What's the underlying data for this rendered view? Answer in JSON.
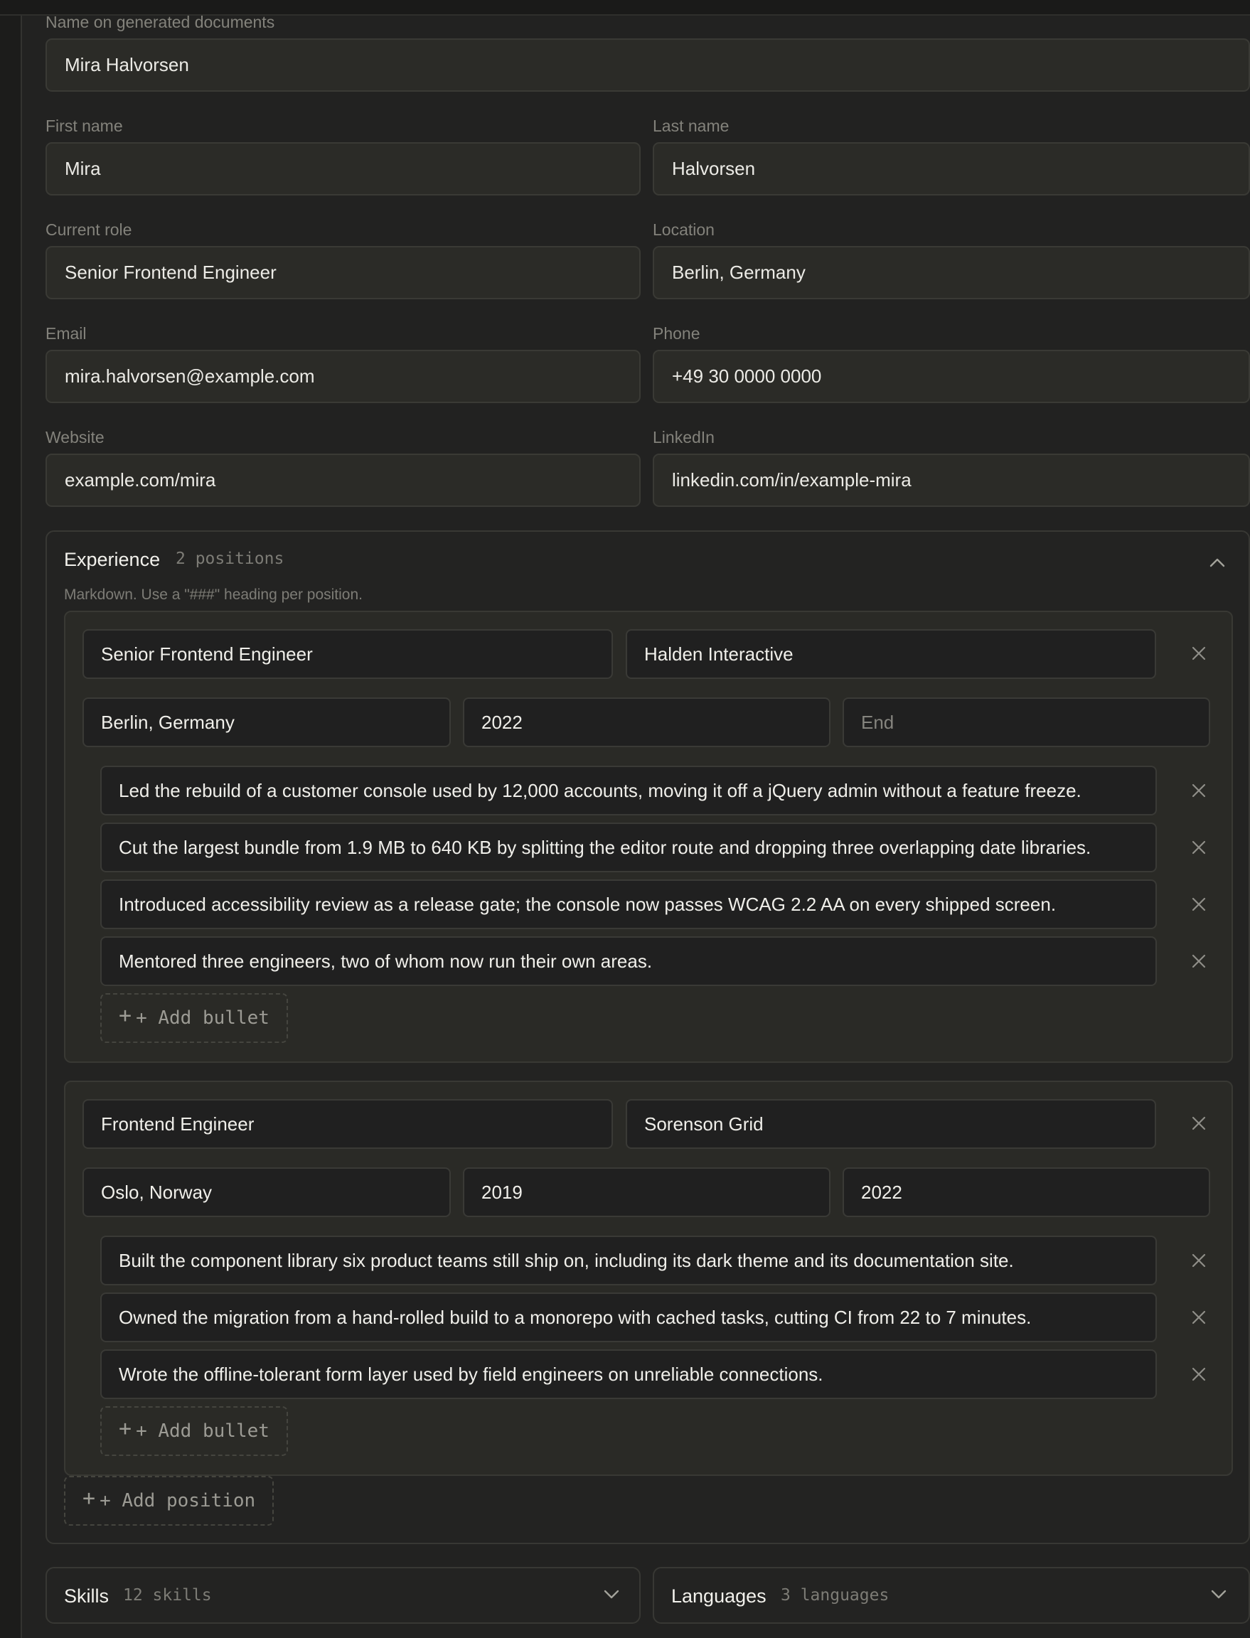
{
  "identity": {
    "display_name_label": "Name on generated documents",
    "display_name": "Mira Halvorsen",
    "first_name_label": "First name",
    "first_name": "Mira",
    "last_name_label": "Last name",
    "last_name": "Halvorsen",
    "role_label": "Current role",
    "role": "Senior Frontend Engineer",
    "location_label": "Location",
    "location": "Berlin, Germany",
    "email_label": "Email",
    "email": "mira.halvorsen@example.com",
    "phone_label": "Phone",
    "phone": "+49 30 0000 0000",
    "website_label": "Website",
    "website": "example.com/mira",
    "linkedin_label": "LinkedIn",
    "linkedin": "linkedin.com/in/example-mira"
  },
  "experience": {
    "title": "Experience",
    "count": "2 positions",
    "hint": "Markdown. Use a \"###\" heading per position.",
    "add_position_label": "+ Add position",
    "positions": [
      {
        "title": "Senior Frontend Engineer",
        "company": "Halden Interactive",
        "location": "Berlin, Germany",
        "start": "2022",
        "end": "",
        "end_placeholder": "End",
        "bullets": [
          "Led the rebuild of a customer console used by 12,000 accounts, moving it off a jQuery admin without a feature freeze.",
          "Cut the largest bundle from 1.9 MB to 640 KB by splitting the editor route and dropping three overlapping date libraries.",
          "Introduced accessibility review as a release gate; the console now passes WCAG 2.2 AA on every shipped screen.",
          "Mentored three engineers, two of whom now run their own areas."
        ],
        "add_bullet_label": "+ Add bullet"
      },
      {
        "title": "Frontend Engineer",
        "company": "Sorenson Grid",
        "location": "Oslo, Norway",
        "start": "2019",
        "end": "2022",
        "end_placeholder": "End",
        "bullets": [
          "Built the component library six product teams still ship on, including its dark theme and its documentation site.",
          "Owned the migration from a hand-rolled build to a monorepo with cached tasks, cutting CI from 22 to 7 minutes.",
          "Wrote the offline-tolerant form layer used by field engineers on unreliable connections."
        ],
        "add_bullet_label": "+ Add bullet"
      }
    ]
  },
  "skills": {
    "title": "Skills",
    "count": "12 skills"
  },
  "languages": {
    "title": "Languages",
    "count": "3 languages"
  },
  "colors": {
    "background": "#222221",
    "field": "#2b2b27",
    "card": "#2a2a26",
    "inner_field": "#202020",
    "muted_text": "#83827b"
  },
  "icons": {
    "remove": "close-icon",
    "collapse": "chevron-up-icon",
    "expand": "chevron-down-icon",
    "add": "plus-icon"
  }
}
